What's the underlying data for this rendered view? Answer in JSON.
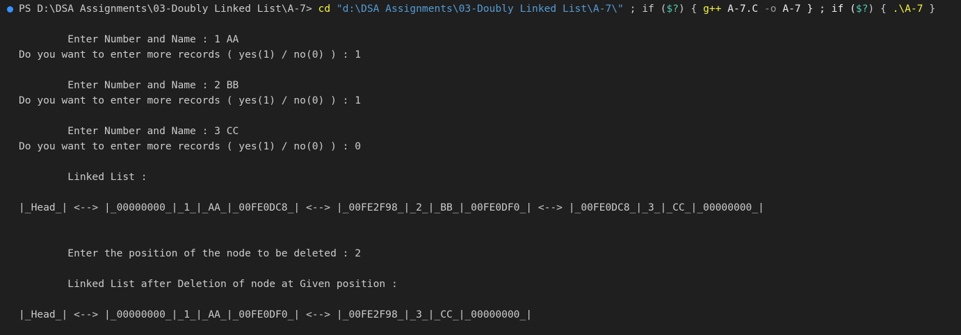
{
  "terminal": {
    "prompt": {
      "ps": "PS ",
      "path": "D:\\DSA Assignments\\03-Doubly Linked List\\A-7>",
      "cmd_cd": " cd",
      "cd_arg": " \"d:\\DSA Assignments\\03-Doubly Linked List\\A-7\\\"",
      "sep1": " ; if (",
      "var1": "$?",
      "after_var1": ") { ",
      "gpp": "g++",
      "gpp_args1": " A-7.C ",
      "gpp_flag": "-o",
      "gpp_args2": " A-7 } ; if (",
      "var2": "$?",
      "after_var2": ") { ",
      "run": ".\\A-7",
      "tail": " }"
    },
    "lines": [
      "        Enter Number and Name : 1 AA",
      "Do you want to enter more records ( yes(1) / no(0) ) : 1",
      "        Enter Number and Name : 2 BB",
      "Do you want to enter more records ( yes(1) / no(0) ) : 1",
      "        Enter Number and Name : 3 CC",
      "Do you want to enter more records ( yes(1) / no(0) ) : 0",
      "        Linked List :",
      "|_Head_| <--> |_00000000_|_1_|_AA_|_00FE0DC8_| <--> |_00FE2F98_|_2_|_BB_|_00FE0DF0_| <--> |_00FE0DC8_|_3_|_CC_|_00000000_|",
      "        Enter the position of the node to be deleted : 2",
      "        Linked List after Deletion of node at Given position :",
      "|_Head_| <--> |_00000000_|_1_|_AA_|_00FE0DF0_| <--> |_00FE2F98_|_3_|_CC_|_00000000_|"
    ]
  }
}
